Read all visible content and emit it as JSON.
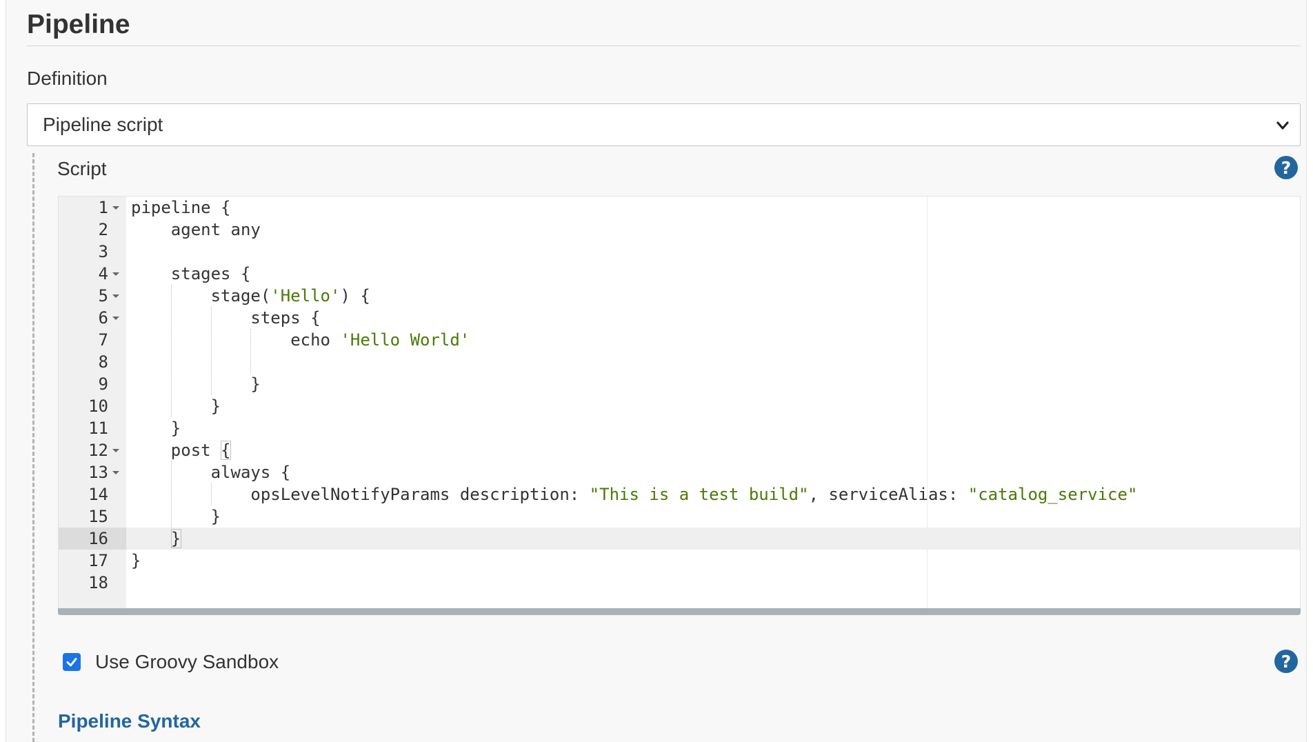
{
  "section": {
    "title": "Pipeline"
  },
  "definition": {
    "label": "Definition",
    "selected": "Pipeline script"
  },
  "script": {
    "label": "Script",
    "active_line": 16,
    "lines": [
      {
        "n": "1",
        "fold": true,
        "text": "pipeline {"
      },
      {
        "n": "2",
        "fold": false,
        "text": "    agent any"
      },
      {
        "n": "3",
        "fold": false,
        "text": ""
      },
      {
        "n": "4",
        "fold": true,
        "text": "    stages {"
      },
      {
        "n": "5",
        "fold": true,
        "text": "        stage('Hello') {"
      },
      {
        "n": "6",
        "fold": true,
        "text": "            steps {"
      },
      {
        "n": "7",
        "fold": false,
        "text": "                echo 'Hello World'"
      },
      {
        "n": "8",
        "fold": false,
        "text": ""
      },
      {
        "n": "9",
        "fold": false,
        "text": "            }"
      },
      {
        "n": "10",
        "fold": false,
        "text": "        }"
      },
      {
        "n": "11",
        "fold": false,
        "text": "    }"
      },
      {
        "n": "12",
        "fold": true,
        "text": "    post {"
      },
      {
        "n": "13",
        "fold": true,
        "text": "        always {"
      },
      {
        "n": "14",
        "fold": false,
        "text": "            opsLevelNotifyParams description: \"This is a test build\", serviceAlias: \"catalog_service\""
      },
      {
        "n": "15",
        "fold": false,
        "text": "        }"
      },
      {
        "n": "16",
        "fold": false,
        "text": "    }"
      },
      {
        "n": "17",
        "fold": false,
        "text": "}"
      },
      {
        "n": "18",
        "fold": false,
        "text": ""
      }
    ]
  },
  "sandbox": {
    "label": "Use Groovy Sandbox",
    "checked": true
  },
  "syntax_link": {
    "label": "Pipeline Syntax"
  },
  "icons": {
    "help": "?"
  },
  "colors": {
    "accent": "#22669f",
    "string": "#4a7a06",
    "checkbox": "#1a73e8"
  }
}
